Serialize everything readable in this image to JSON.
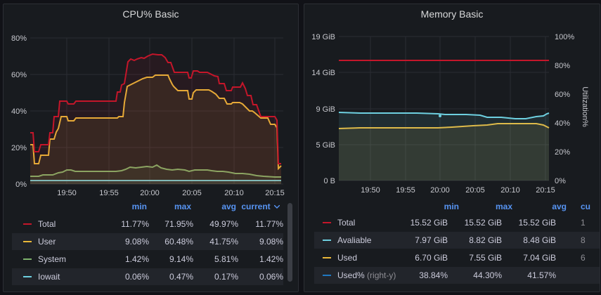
{
  "cpu": {
    "title": "CPU% Basic",
    "yticks": [
      "80%",
      "60%",
      "40%",
      "20%",
      "0%"
    ],
    "xticks": [
      "19:50",
      "19:55",
      "20:00",
      "20:05",
      "20:10",
      "20:15"
    ],
    "legend_headers": {
      "min": "min",
      "max": "max",
      "avg": "avg",
      "current": "current"
    },
    "sort_icon": "chevron-down-icon",
    "series": [
      {
        "name": "Total",
        "color": "#c4162a",
        "min": "11.77%",
        "max": "71.95%",
        "avg": "49.97%",
        "current": "11.77%"
      },
      {
        "name": "User",
        "color": "#eab839",
        "min": "9.08%",
        "max": "60.48%",
        "avg": "41.75%",
        "current": "9.08%"
      },
      {
        "name": "System",
        "color": "#7eb26d",
        "min": "1.42%",
        "max": "9.14%",
        "avg": "5.81%",
        "current": "1.42%"
      },
      {
        "name": "Iowait",
        "color": "#6ed0e0",
        "min": "0.06%",
        "max": "0.47%",
        "avg": "0.17%",
        "current": "0.06%"
      }
    ]
  },
  "memory": {
    "title": "Memory Basic",
    "yticks_left": [
      "19 GiB",
      "14 GiB",
      "9 GiB",
      "5 GiB",
      "0 B"
    ],
    "yticks_right": [
      "100%",
      "80%",
      "60%",
      "40%",
      "20%",
      "0%"
    ],
    "right_axis_label": "Utilization%",
    "xticks": [
      "19:50",
      "19:55",
      "20:00",
      "20:05",
      "20:10",
      "20:15"
    ],
    "legend_headers": {
      "min": "min",
      "max": "max",
      "avg": "avg",
      "current": "cu"
    },
    "series": [
      {
        "name": "Total",
        "suffix": "",
        "color": "#c4162a",
        "min": "15.52 GiB",
        "max": "15.52 GiB",
        "avg": "15.52 GiB",
        "current": "1"
      },
      {
        "name": "Avaliable",
        "suffix": "",
        "color": "#6ed0e0",
        "min": "7.97 GiB",
        "max": "8.82 GiB",
        "avg": "8.48 GiB",
        "current": "8"
      },
      {
        "name": "Used",
        "suffix": "",
        "color": "#eab839",
        "min": "6.70 GiB",
        "max": "7.55 GiB",
        "avg": "7.04 GiB",
        "current": "6"
      },
      {
        "name": "Used%",
        "suffix": "(right-y)",
        "color": "#1f78c1",
        "min": "38.84%",
        "max": "44.30%",
        "avg": "41.57%",
        "current": ""
      }
    ]
  }
}
